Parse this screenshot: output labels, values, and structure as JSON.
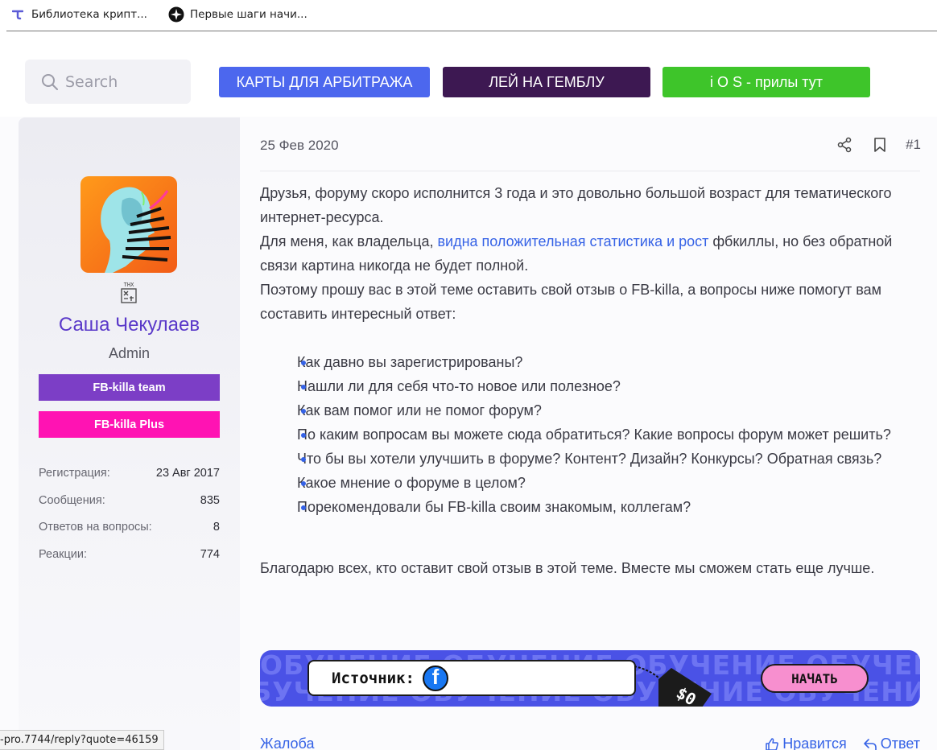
{
  "bookmarks": [
    {
      "label": "Библиотека крипт...",
      "icon": "t-logo-icon"
    },
    {
      "label": "Первые шаги начи...",
      "icon": "compass-icon"
    }
  ],
  "header": {
    "search_placeholder": "Search",
    "buttons": [
      {
        "label": "КАРТЫ ДЛЯ АРБИТРАЖА",
        "color": "#4c67ee"
      },
      {
        "label": "ЛЕЙ НА ГЕМБЛУ",
        "color": "#3d1852"
      },
      {
        "label": "i O S - прилы тут",
        "color": "#3ec52a"
      }
    ]
  },
  "user": {
    "name": "Саша Чекулаев",
    "role": "Admin",
    "thx_label": "THX",
    "banners": [
      "FB-killa team",
      "FB-killa Plus"
    ],
    "stats": [
      {
        "label": "Регистрация:",
        "value": "23 Авг 2017"
      },
      {
        "label": "Сообщения:",
        "value": "835"
      },
      {
        "label": "Ответов на вопросы:",
        "value": "8"
      },
      {
        "label": "Реакции:",
        "value": "774"
      }
    ]
  },
  "post": {
    "date": "25 Фев 2020",
    "number": "#1",
    "intro_1": "Друзья, форуму скоро исполнится 3 года и это довольно большой возраст для тематического интернет-ресурса.",
    "intro_2_before": "Для меня, как владельца, ",
    "intro_2_link": "видна положительная статистика и рост",
    "intro_2_after": " фбкиллы, но без обратной связи картина никогда не будет полной.",
    "intro_3": "Поэтому прошу вас в этой теме оставить свой отзыв о FB-killa, а вопросы ниже помогут вам составить интересный ответ:",
    "questions": [
      "Как давно вы зарегистрированы?",
      "Нашли ли для себя что-то новое или полезное?",
      "Как вам помог или не помог форум?",
      "По каким вопросам вы можете сюда обратиться? Какие вопросы форум может решить?",
      "Что бы вы хотели улучшить в форуме? Контент? Дизайн? Конкурсы? Обратная связь?",
      "Какое мнение о форуме в целом?",
      "Порекомендовали бы FB-killa своим знакомым, коллегам?"
    ],
    "thanks": "Благодарю всех, кто оставит свой отзыв в этой теме. Вместе мы сможем стать еще лучше."
  },
  "ad": {
    "bg_text": "ОБУЧЕНИЕ ОБУЧЕНИЕ ОБУЧЕНИЕ ОБУЧЕНИЕ ОБУЧЕНИЕ",
    "source_label": "Источник:",
    "tag_text": "$0",
    "button": "НАЧАТЬ"
  },
  "footer": {
    "report": "Жалоба",
    "like": "Нравится",
    "reply": "Ответ"
  },
  "status_url": "-pro.7744/reply?quote=46159"
}
